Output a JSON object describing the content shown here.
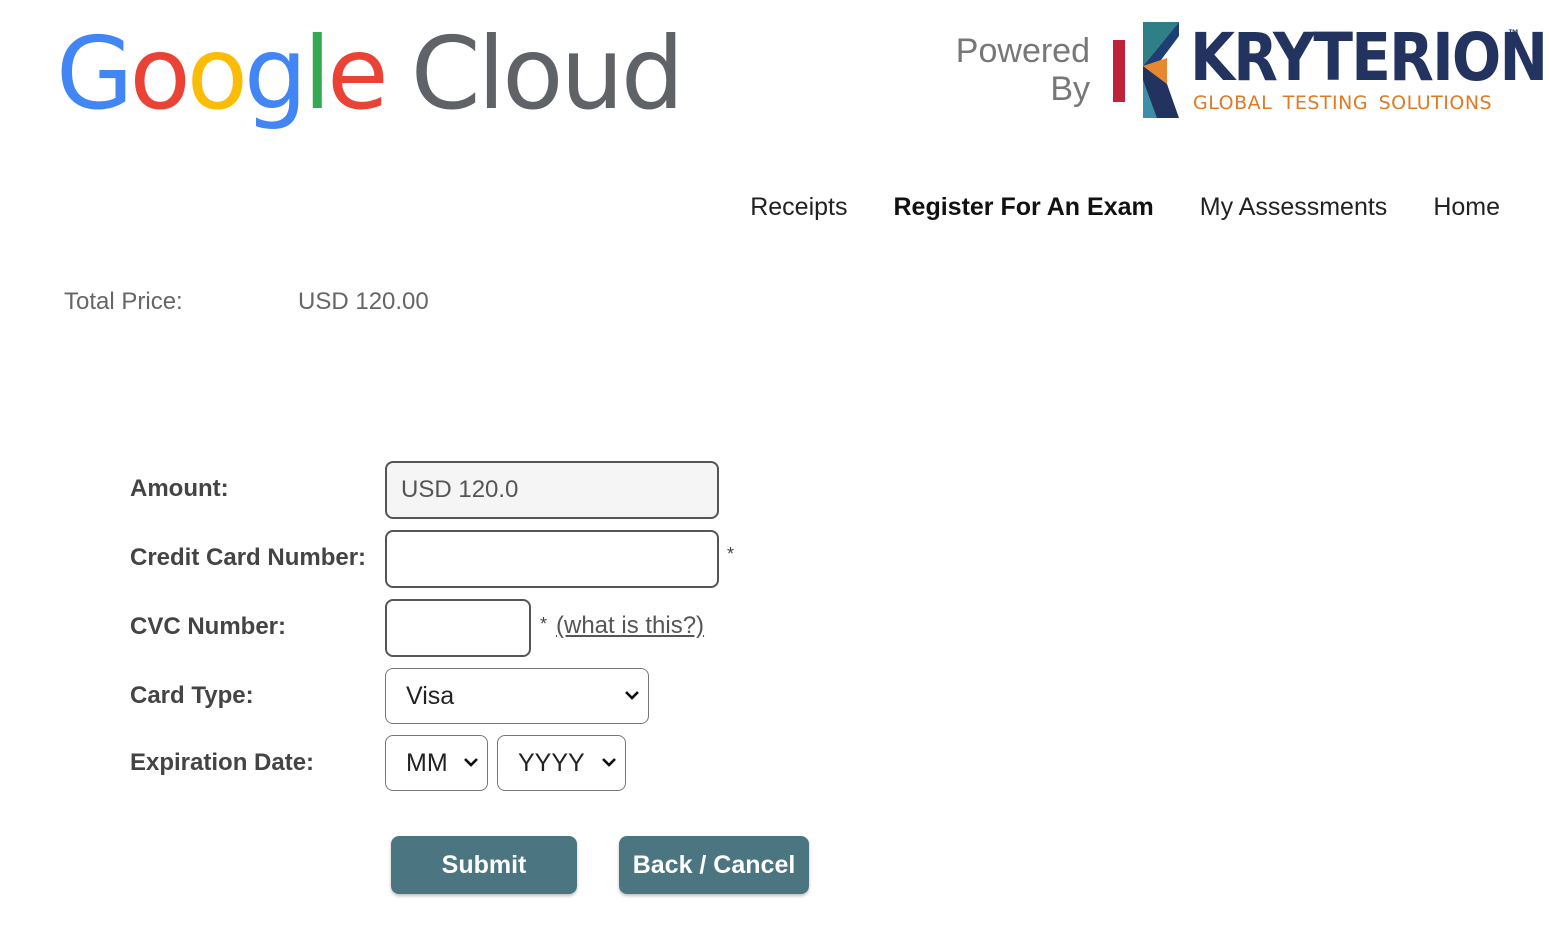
{
  "header": {
    "google_logo": {
      "letters": [
        "G",
        "o",
        "o",
        "g",
        "l",
        "e"
      ],
      "colors": [
        "#4285F4",
        "#EA4335",
        "#FBBC05",
        "#4285F4",
        "#34A853",
        "#EA4335"
      ],
      "cloud_word": "Cloud"
    },
    "powered_line1": "Powered",
    "powered_line2": "By",
    "kryterion_name": "KRYTERION",
    "kryterion_tm": "™",
    "kryterion_tagline": "GLOBAL TESTING SOLUTIONS",
    "colors": {
      "kryterion_navy": "#22335f",
      "kryterion_orange": "#e07a24",
      "kryterion_red": "#c0223a"
    }
  },
  "nav": {
    "items": [
      {
        "label": "Receipts"
      },
      {
        "label": "Register For An Exam"
      },
      {
        "label": "My Assessments"
      },
      {
        "label": "Home"
      }
    ],
    "active": "Register For An Exam"
  },
  "summary": {
    "total_label": "Total Price:",
    "total_value": "USD 120.00"
  },
  "payment": {
    "amount_label": "Amount:",
    "amount_value": "USD 120.0",
    "card_number_label": "Credit Card Number:",
    "card_number_value": "",
    "cvc_label": "CVC Number:",
    "cvc_value": "",
    "required_marker": "*",
    "what_is_this": "(what is this?)",
    "card_type_label": "Card Type:",
    "card_type_value": "Visa",
    "expiration_label": "Expiration Date:",
    "exp_month_value": "MM",
    "exp_year_value": "YYYY"
  },
  "buttons": {
    "submit": "Submit",
    "back_cancel": "Back / Cancel",
    "color": "#4a7581"
  }
}
